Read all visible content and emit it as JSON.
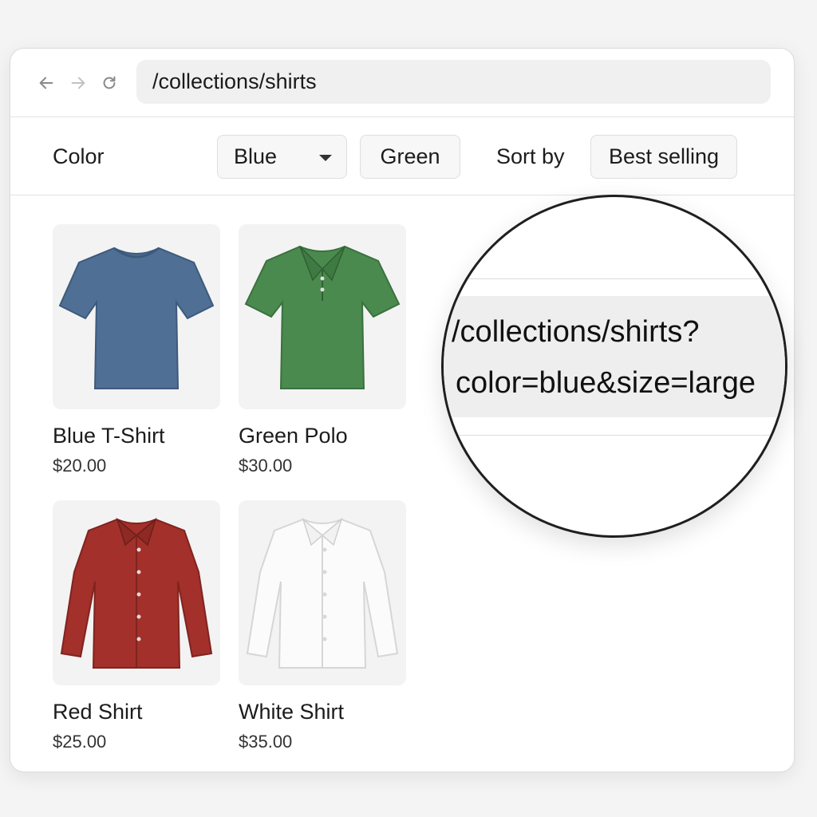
{
  "browser": {
    "back_icon": "arrow-left-icon",
    "forward_icon": "arrow-right-icon",
    "reload_icon": "reload-icon",
    "url": "/collections/shirts"
  },
  "filters": {
    "color_label": "Color",
    "color_selected": "Blue",
    "color_option_2": "Green",
    "sort_label": "Sort by",
    "sort_selected": "Best selling"
  },
  "products": [
    {
      "name": "Blue T-Shirt",
      "price": "$20.00",
      "color": "#4f6f94"
    },
    {
      "name": "Green Polo",
      "price": "$30.00",
      "color": "#4a8a4e"
    },
    {
      "name": "Red Shirt",
      "price": "$25.00",
      "color": "#a3302a"
    },
    {
      "name": "White Shirt",
      "price": "$35.00",
      "color": "#f7f7f7"
    }
  ],
  "magnifier": {
    "line1": "/collections/shirts?",
    "line2": "color=blue&size=large"
  }
}
